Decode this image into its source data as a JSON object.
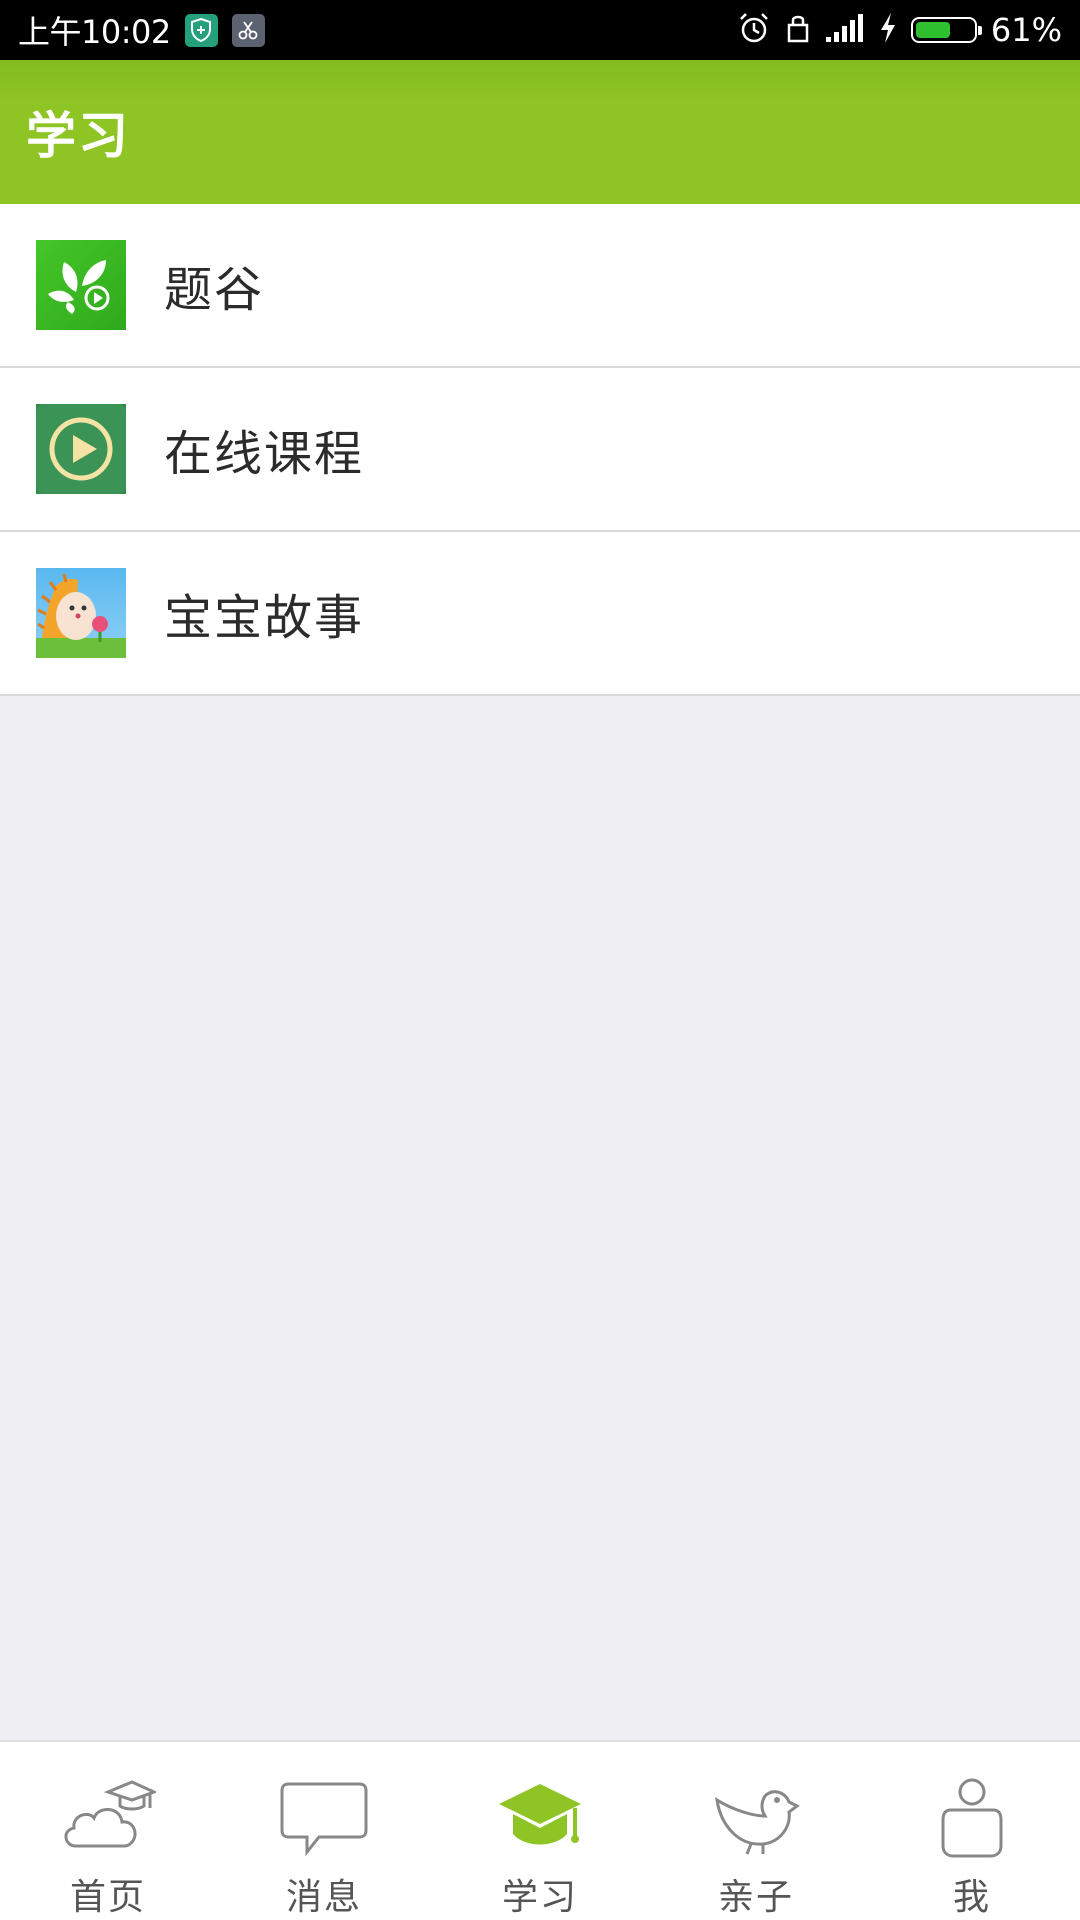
{
  "status_bar": {
    "time": "上午10:02",
    "battery_percent": "61%",
    "battery_level": 0.61,
    "icons": [
      "shield-icon",
      "scissors-icon",
      "alarm-icon",
      "lock-icon",
      "signal-icon",
      "charging-icon",
      "battery-icon"
    ]
  },
  "app_bar": {
    "title": "学习",
    "color": "#8fc425"
  },
  "list": {
    "items": [
      {
        "label": "题谷",
        "icon": "tigu-leaf-icon"
      },
      {
        "label": "在线课程",
        "icon": "online-course-play-icon"
      },
      {
        "label": "宝宝故事",
        "icon": "baby-story-hedgehog-icon"
      }
    ]
  },
  "bottom_nav": {
    "items": [
      {
        "label": "首页",
        "icon": "cloud-cap-icon",
        "active": false
      },
      {
        "label": "消息",
        "icon": "chat-bubble-icon",
        "active": false
      },
      {
        "label": "学习",
        "icon": "graduation-cap-icon",
        "active": true
      },
      {
        "label": "亲子",
        "icon": "bird-icon",
        "active": false
      },
      {
        "label": "我",
        "icon": "person-icon",
        "active": false
      }
    ],
    "active_color": "#8fc425"
  }
}
